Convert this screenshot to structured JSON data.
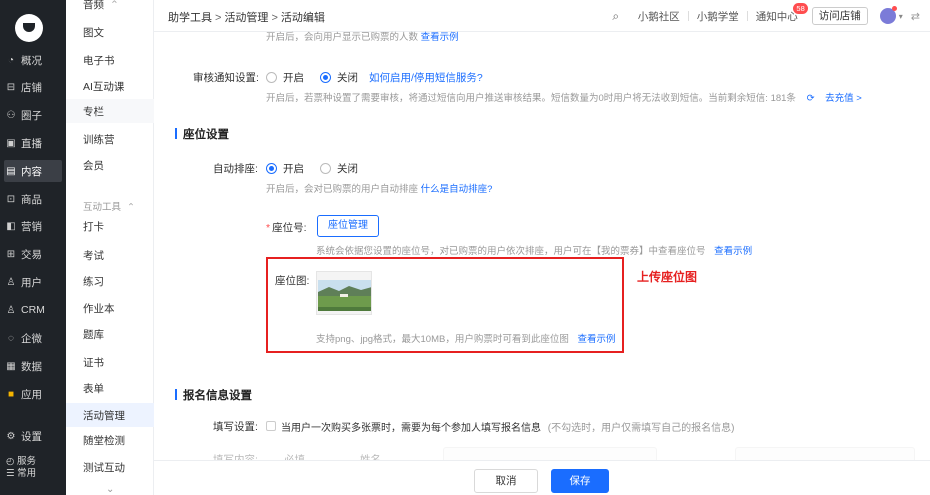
{
  "nav": {
    "items": [
      {
        "icon": "clock-icon",
        "glyph": "◔",
        "label": "概况"
      },
      {
        "icon": "store-icon",
        "glyph": "⊟",
        "label": "店铺"
      },
      {
        "icon": "group-icon",
        "glyph": "⚇",
        "label": "圈子"
      },
      {
        "icon": "live-icon",
        "glyph": "▣",
        "label": "直播"
      },
      {
        "icon": "content-icon",
        "glyph": "▤",
        "label": "内容"
      },
      {
        "icon": "goods-icon",
        "glyph": "⊡",
        "label": "商品"
      },
      {
        "icon": "marketing-icon",
        "glyph": "◧",
        "label": "营销"
      },
      {
        "icon": "trade-icon",
        "glyph": "⊞",
        "label": "交易"
      },
      {
        "icon": "user-icon",
        "glyph": "♙",
        "label": "用户"
      },
      {
        "icon": "crm-icon",
        "glyph": "♙",
        "label": "CRM"
      },
      {
        "icon": "wecom-icon",
        "glyph": "◌",
        "label": "企微"
      },
      {
        "icon": "data-icon",
        "glyph": "▦",
        "label": "数据"
      },
      {
        "icon": "apps-icon",
        "glyph": "■",
        "label": "应用"
      },
      {
        "icon": "settings-icon",
        "glyph": "⚙",
        "label": "设置"
      }
    ],
    "service": "服务",
    "common": "常用"
  },
  "submenu": {
    "top_partial": "音频",
    "items_a": [
      "图文",
      "电子书",
      "AI互动课",
      "专栏",
      "训练营",
      "会员"
    ],
    "group_label": "互动工具",
    "items_b": [
      "打卡",
      "考试",
      "练习",
      "作业本",
      "题库",
      "证书",
      "表单",
      "活动管理",
      "随堂检测",
      "测试互动"
    ]
  },
  "header": {
    "breadcrumb": [
      "助学工具",
      "活动管理",
      "活动编辑"
    ],
    "community": "小鹅社区",
    "school": "小鹅学堂",
    "notice": "通知中心",
    "notice_count": "58",
    "visit_store": "访问店铺"
  },
  "form": {
    "partial_top_tip": "开启后，会向用户显示已购票的人数",
    "partial_top_link": "查看示例",
    "review_label": "审核通知设置:",
    "on": "开启",
    "off": "关闭",
    "review_help_link": "如何启用/停用短信服务?",
    "review_tip": "开启后，若票种设置了需要审核，将通过短信向用户推送审核结果。短信数量为0时用户将无法收到短信。当前剩余短信: 181条",
    "recharge": "去充值 >",
    "seat_section": "座位设置",
    "auto_seat_label": "自动排座:",
    "auto_seat_tip": "开启后，会对已购票的用户自动排座",
    "auto_seat_link": "什么是自动排座?",
    "seat_no_label": "座位号:",
    "seat_manage_btn": "座位管理",
    "seat_no_tip": "系统会依据您设置的座位号，对已购票的用户依次排座，用户可在【我的票券】中查看座位号",
    "seat_no_link": "查看示例",
    "seat_map_label": "座位图:",
    "seat_map_tip": "支持png、jpg格式，最大10MB，用户购票时可看到此座位图",
    "seat_map_link": "查看示例",
    "annotation": "上传座位图",
    "signup_section": "报名信息设置",
    "fill_label": "填写设置:",
    "fill_option": "当用户一次购买多张票时，需要为每个参加人填写报名信息",
    "fill_note": "(不勾选时，用户仅需填写自己的报名信息)",
    "cut_label": "填写内容:",
    "cut_field1": "必填",
    "cut_field2": "姓名"
  },
  "actions": {
    "cancel": "取消",
    "save": "保存"
  },
  "colors": {
    "primary": "#1a6dff",
    "annotation": "#e62020",
    "nav_bg": "#1f2328"
  }
}
